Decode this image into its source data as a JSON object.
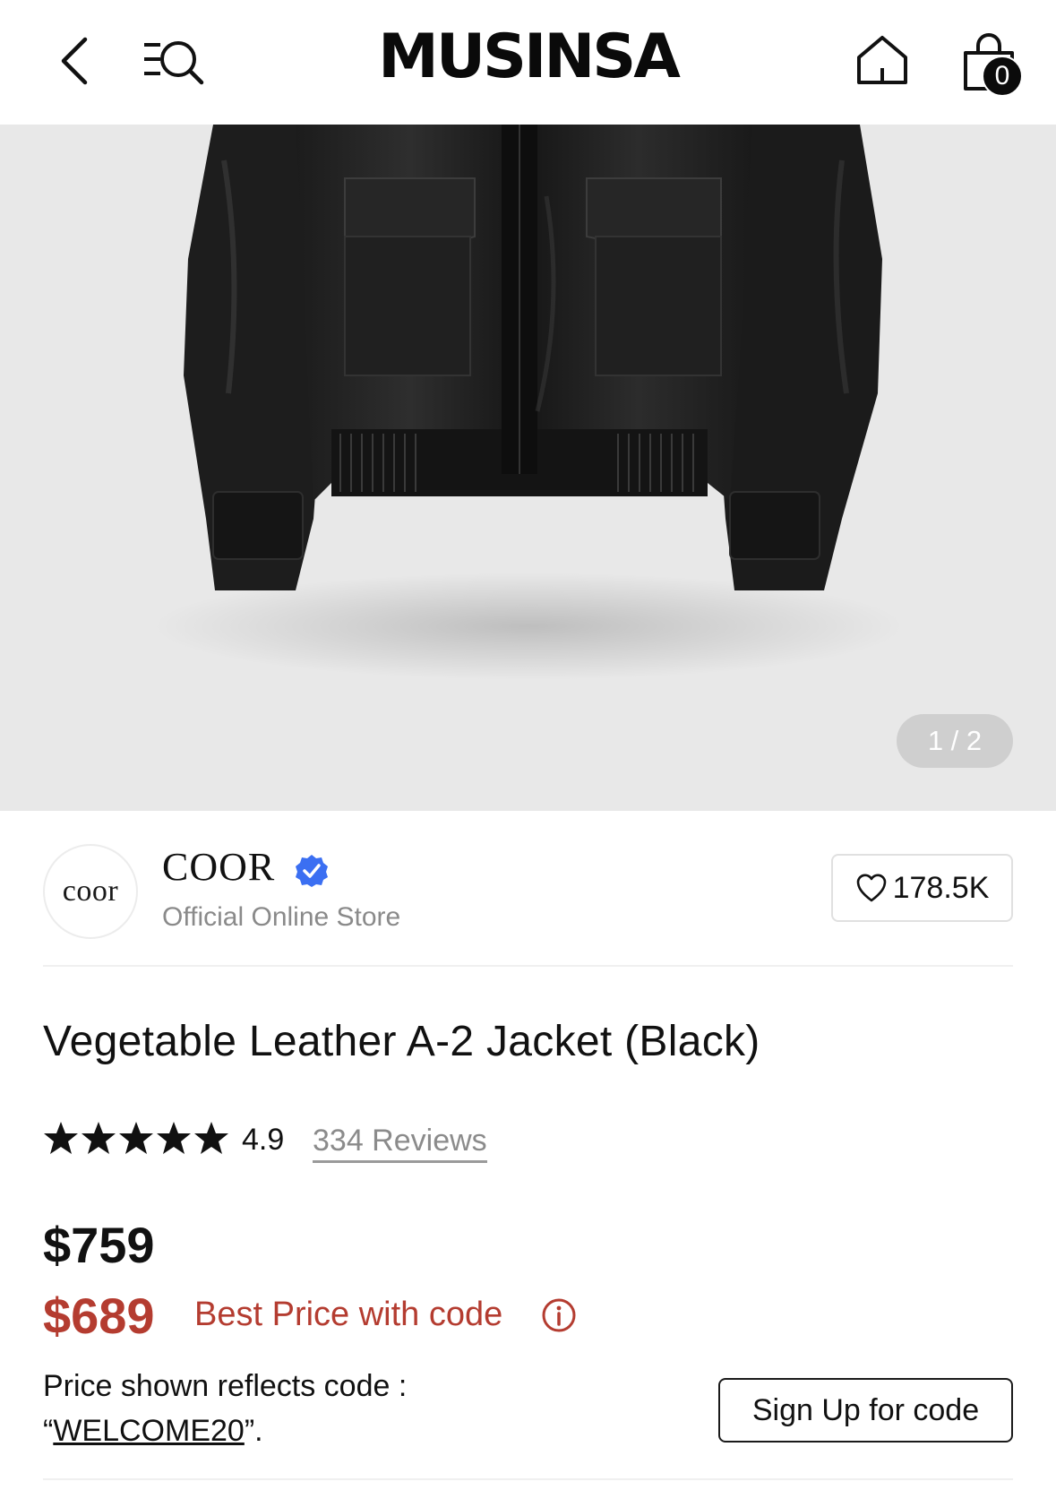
{
  "header": {
    "logo": "MUSINSA",
    "cart_count": "0"
  },
  "gallery": {
    "counter": "1 / 2"
  },
  "brand": {
    "logo_text": "coor",
    "name": "COOR",
    "subtitle": "Official Online Store",
    "likes": "178.5K",
    "verified_color": "#3b6ff2"
  },
  "product": {
    "title": "Vegetable Leather A-2 Jacket (Black)",
    "rating": "4.9",
    "stars": 5,
    "reviews": "334 Reviews",
    "price": "$759",
    "sale_price": "$689",
    "best_price_label": "Best Price with code",
    "code_note_line1": "Price shown reflects code :",
    "code_open_quote": "“",
    "code": "WELCOME20",
    "code_close": "”.",
    "signup_button": "Sign Up for code"
  },
  "colors": {
    "accent_red": "#b43c30",
    "text": "#111111",
    "muted": "#8a8a8a"
  }
}
